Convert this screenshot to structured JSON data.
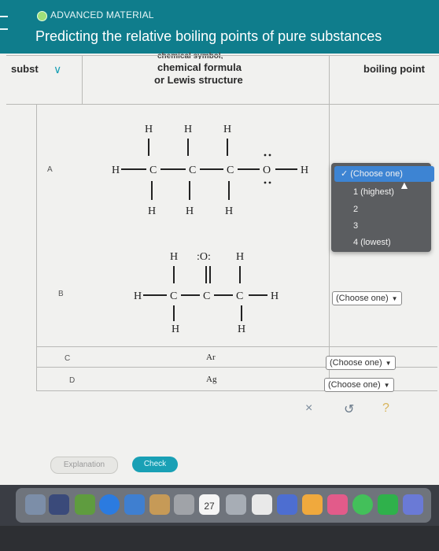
{
  "header": {
    "kicker": "ADVANCED MATERIAL",
    "title": "Predicting the relative boiling points of pure substances"
  },
  "table": {
    "col_substance": "subst",
    "col_formula_top": "chemical symbol,",
    "col_formula_line1": "chemical formula",
    "col_formula_line2": "or Lewis structure",
    "col_boiling": "boiling point"
  },
  "rows": [
    {
      "label": "A"
    },
    {
      "label": "B"
    },
    {
      "label": "C",
      "formula": "Ar"
    },
    {
      "label": "D",
      "formula": "Ag"
    }
  ],
  "molecules": {
    "propanol": {
      "top_h": [
        "H",
        "H",
        "H"
      ],
      "chain": [
        "H",
        "C",
        "C",
        "C",
        "O",
        "H"
      ],
      "bottom_h": [
        "H",
        "H",
        "H"
      ]
    },
    "acetone": {
      "top": [
        "H",
        ":O:",
        "H"
      ],
      "chain": [
        "H",
        "C",
        "C",
        "C",
        "H"
      ],
      "bottom_h": [
        "H",
        "H"
      ]
    }
  },
  "dropdown_open": {
    "selected": "✓ (Choose one)",
    "options": [
      "1 (highest)",
      "2",
      "3",
      "4 (lowest)"
    ]
  },
  "dropdowns": {
    "b": "(Choose one)",
    "c": "(Choose one)",
    "d": "(Choose one)"
  },
  "tools": {
    "clear": "×",
    "undo": "↺",
    "help": "?"
  },
  "buttons": {
    "explanation": "Explanation",
    "check": "Check"
  },
  "dock": {
    "calendar_day": "27"
  },
  "colors": {
    "header": "#0f7d8c",
    "accent": "#19a0b5",
    "check_button": "#19a0b5"
  }
}
